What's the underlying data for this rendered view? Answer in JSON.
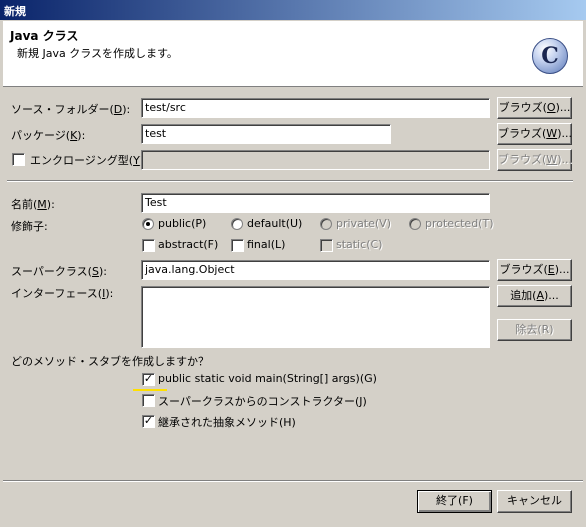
{
  "window": {
    "title": "新規"
  },
  "banner": {
    "title": "Java クラス",
    "description": "新規 Java クラスを作成します。",
    "icon_letter": "C"
  },
  "source_folder": {
    "label": "ソース・フォルダー(",
    "mnemonic": "D",
    "label_end": "):",
    "value": "test/src",
    "browse": "ブラウズ(",
    "browse_key": "O",
    "browse_end": ")..."
  },
  "package": {
    "label": "パッケージ(",
    "mnemonic": "K",
    "label_end": "):",
    "value": "test",
    "browse": "ブラウズ(",
    "browse_key": "W",
    "browse_end": ")..."
  },
  "enclosing": {
    "label": "エンクロージング型(",
    "mnemonic": "Y",
    "label_end": "):",
    "value": "",
    "browse": "ブラウズ(",
    "browse_key": "W",
    "browse_end": ")..."
  },
  "name": {
    "label": "名前(",
    "mnemonic": "M",
    "label_end": "):",
    "value": "Test"
  },
  "modifiers": {
    "label": "修飾子:",
    "public": "public(P)",
    "default": "default(U)",
    "private": "private(V)",
    "protected": "protected(T)",
    "abstract": "abstract(F)",
    "final": "final(L)",
    "static": "static(C)"
  },
  "superclass": {
    "label": "スーパークラス(",
    "mnemonic": "S",
    "label_end": "):",
    "value": "java.lang.Object",
    "browse": "ブラウズ(",
    "browse_key": "E",
    "browse_end": ")..."
  },
  "interfaces": {
    "label": "インターフェース(",
    "mnemonic": "I",
    "label_end": "):",
    "add": "追加(",
    "add_key": "A",
    "add_end": ")...",
    "remove": "除去(R)"
  },
  "stubs": {
    "question": "どのメソッド・スタブを作成しますか？",
    "main": "public static void main(String[] args)(G)",
    "constructors": "スーパークラスからのコンストラクター(J)",
    "inherited": "継承された抽象メソッド(H)"
  },
  "footer": {
    "finish": "終了(F)",
    "cancel": "キャンセル"
  }
}
